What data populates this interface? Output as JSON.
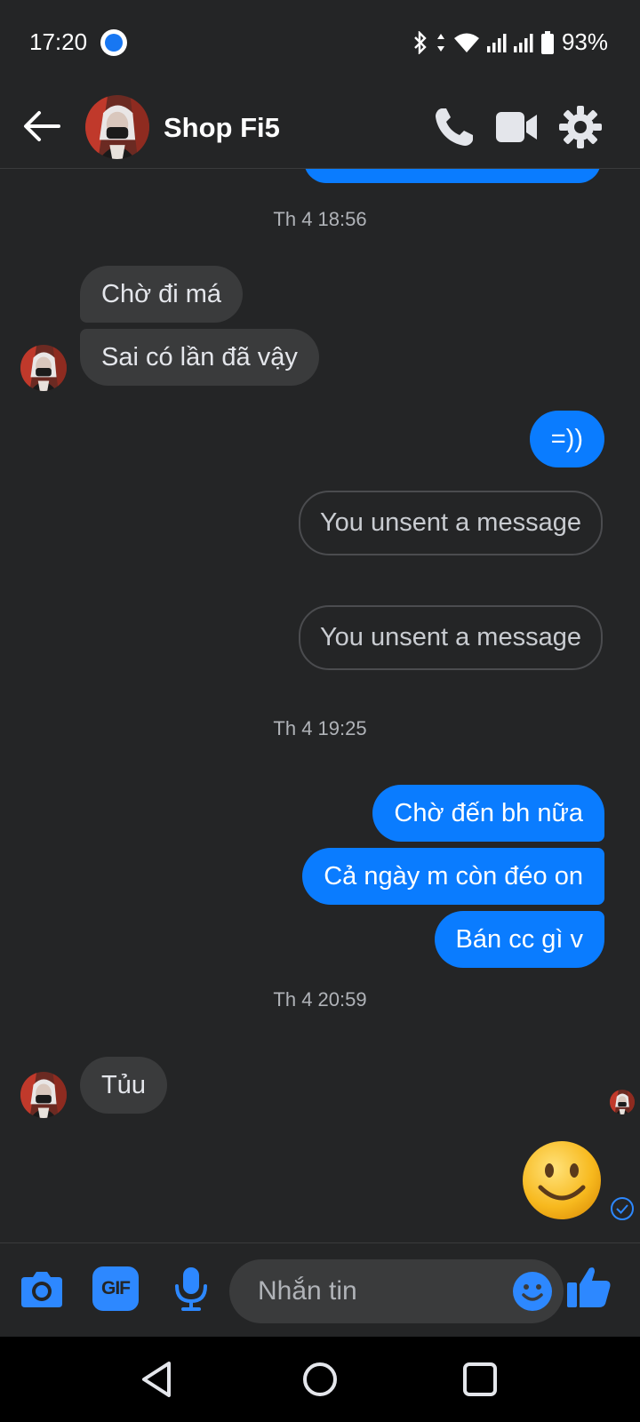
{
  "status_bar": {
    "time": "17:20",
    "battery": "93%"
  },
  "header": {
    "contact_name": "Shop Fi5"
  },
  "messages": {
    "ts1": "Th 4 18:56",
    "in1": "Chờ đi má",
    "in2": "Sai có lần đã vậy",
    "out1": "=))",
    "unsent1": "You unsent a message",
    "unsent2": "You unsent a message",
    "ts2": "Th 4 19:25",
    "out2": "Chờ đến bh nữa",
    "out3": "Cả ngày m còn đéo on",
    "out4": "Bán cc gì v",
    "ts3": "Th 4 20:59",
    "in3": "Tủu"
  },
  "composer": {
    "placeholder": "Nhắn tin",
    "gif_label": "GIF"
  },
  "colors": {
    "accent": "#0a7cff",
    "background": "#242526",
    "incoming_bubble": "#3a3b3c",
    "icon_blue": "#2d88ff"
  },
  "icons": {
    "back": "arrow-left-icon",
    "call": "phone-icon",
    "video": "video-camera-icon",
    "settings": "gear-icon",
    "camera": "camera-icon",
    "gif": "gif-icon",
    "mic": "microphone-icon",
    "emoji": "emoji-icon",
    "like": "thumbs-up-icon"
  }
}
